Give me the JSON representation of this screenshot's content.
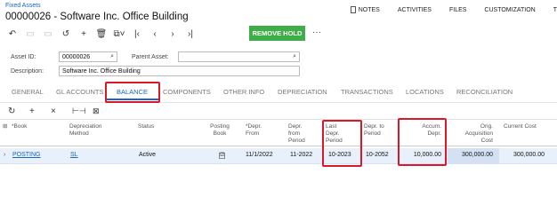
{
  "header": {
    "breadcrumb": "Fixed Assets",
    "title": "00000026 - Software Inc. Office Building",
    "links": [
      "NOTES",
      "ACTIVITIES",
      "FILES",
      "CUSTOMIZATION",
      "T"
    ]
  },
  "toolbar": {
    "remove_hold_label": "REMOVE HOLD",
    "more": "···"
  },
  "form": {
    "asset_id_label": "Asset ID:",
    "asset_id_value": "00000026",
    "parent_asset_label": "Parent Asset:",
    "parent_asset_value": "",
    "description_label": "Description:",
    "description_value": "Software Inc. Office Building"
  },
  "tabs": [
    "GENERAL",
    "GL ACCOUNTS",
    "BALANCE",
    "COMPONENTS",
    "OTHER INFO",
    "DEPRECIATION",
    "TRANSACTIONS",
    "LOCATIONS",
    "RECONCILIATION"
  ],
  "active_tab": "BALANCE",
  "table": {
    "headers": {
      "book": "*Book",
      "depr_method": [
        "Depreciation",
        "Method"
      ],
      "status": "Status",
      "posting_book": [
        "Posting",
        "Book"
      ],
      "depr_from": [
        "*Depr.",
        "From"
      ],
      "depr_from_period": [
        "Depr.",
        "from",
        "Period"
      ],
      "last_depr_period": [
        "Last",
        "Depr.",
        "Period"
      ],
      "depr_to_period": [
        "Depr. to",
        "Period"
      ],
      "accum_depr": [
        "Accum.",
        "Depr."
      ],
      "orig_acq_cost": [
        "Orig.",
        "Acquisition",
        "Cost"
      ],
      "current_cost": "Current Cost"
    },
    "row": {
      "book": "POSTING",
      "depr_method": "SL",
      "status": "Active",
      "posting_book": "☑",
      "depr_from": "11/1/2022",
      "depr_from_period": "11-2022",
      "last_depr_period": "10-2023",
      "depr_to_period": "10-2052",
      "accum_depr": "10,000.00",
      "orig_acq_cost": "300,000.00",
      "current_cost": "300,000.00"
    }
  },
  "colors": {
    "accent": "#1a66c2",
    "remove_hold": "#3fae49",
    "highlight": "#d9192a",
    "row_selected": "#e8f0fb"
  }
}
